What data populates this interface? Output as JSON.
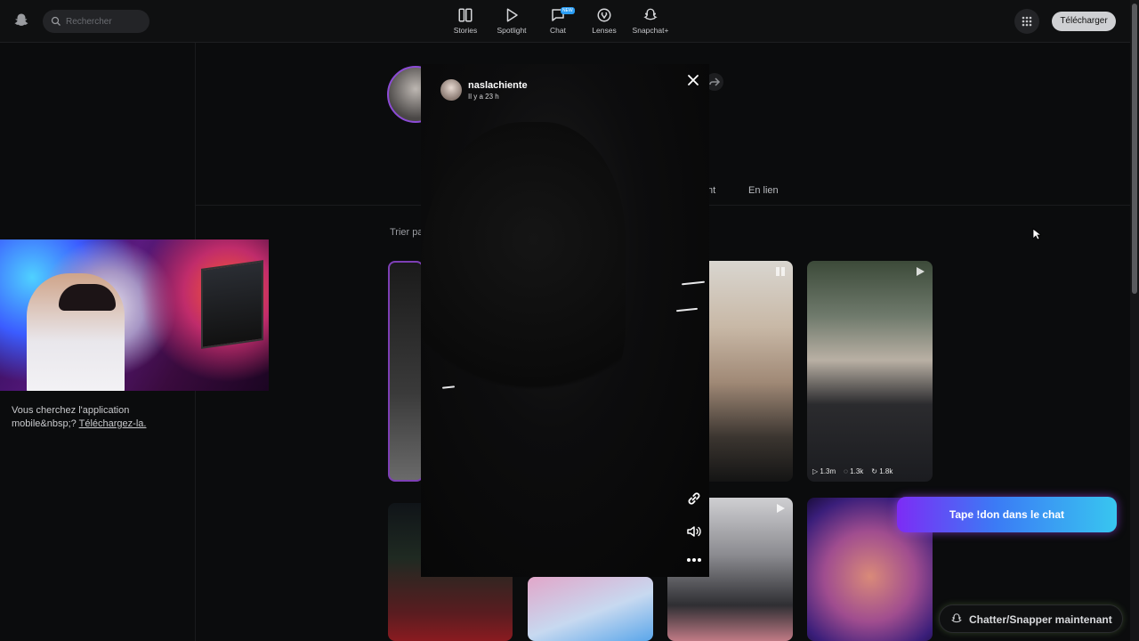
{
  "search": {
    "placeholder": "Rechercher"
  },
  "nav": [
    {
      "label": "Stories",
      "icon": "stories-icon"
    },
    {
      "label": "Spotlight",
      "icon": "spotlight-play-icon"
    },
    {
      "label": "Chat",
      "icon": "chat-bubble-icon",
      "badge": "NEW"
    },
    {
      "label": "Lenses",
      "icon": "lenses-icon"
    },
    {
      "label": "Snapchat+",
      "icon": "ghost-plus-icon"
    }
  ],
  "header": {
    "download_label": "Télécharger"
  },
  "sidebar": {
    "promo_text": "Vous cherchez l'application mobile&nbsp;? ",
    "promo_link": "Téléchargez-la."
  },
  "profile": {
    "tabs": {
      "partial": "nt",
      "linked": "En lien"
    },
    "sort_label": "Trier pa"
  },
  "grid": {
    "card_b2_stats": {
      "views": "1.3m",
      "comments": "1.3k",
      "shares": "1.8k"
    }
  },
  "story": {
    "username": "naslachiente",
    "time": "Il y a 23 h"
  },
  "overlay": {
    "cta_text": "Tape !don dans le chat",
    "chat_now": "Chatter/Snapper maintenant"
  },
  "colors": {
    "accent_purple": "#7d3fb5",
    "cta_gradient_start": "#7d2cf5",
    "cta_gradient_end": "#38c6f0",
    "download_button": "#cfd0d3"
  }
}
